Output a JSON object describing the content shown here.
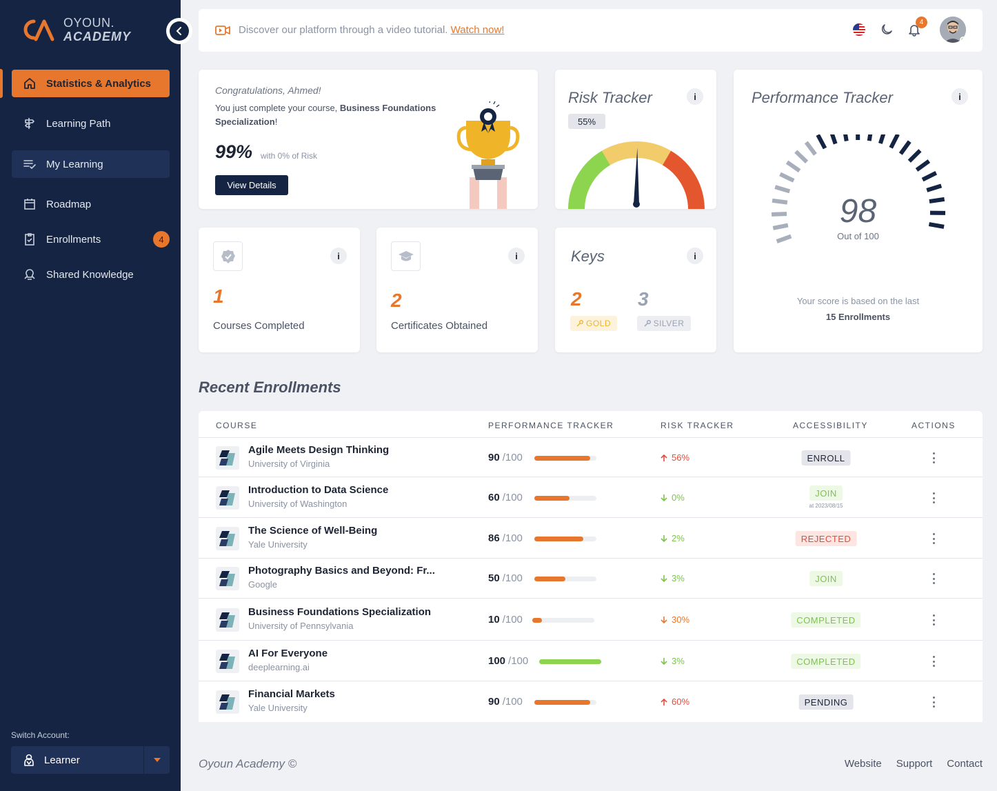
{
  "brand": {
    "line1": "OYOUN.",
    "line2": "ACADEMY",
    "accent": "#e8772e",
    "navy": "#142442"
  },
  "sidebar": {
    "items": [
      {
        "label": "Statistics & Analytics",
        "icon": "home-icon"
      },
      {
        "label": "Learning Path",
        "icon": "signpost-icon"
      },
      {
        "label": "My Learning",
        "icon": "checklist-icon"
      },
      {
        "label": "Roadmap",
        "icon": "calendar-icon"
      },
      {
        "label": "Enrollments",
        "icon": "clipboard-check-icon",
        "badge": "4"
      },
      {
        "label": "Shared Knowledge",
        "icon": "lightbulb-icon"
      }
    ],
    "switch_label": "Switch Account:",
    "switch_value": "Learner"
  },
  "header": {
    "promo_text": "Discover our platform through a video tutorial.",
    "promo_link": "Watch now!",
    "bell_count": "4"
  },
  "congrats": {
    "greeting": "Congratulations, Ahmed!",
    "text_before": "You just complete your course, ",
    "course": "Business Foundations Specialization",
    "text_after": "!",
    "percent": "99%",
    "percent_sub": "with 0% of Risk",
    "button": "View Details"
  },
  "risk_tracker": {
    "title": "Risk Tracker",
    "value": "55%",
    "level": 0.55
  },
  "performance_tracker": {
    "title": "Performance Tracker",
    "score": "98",
    "out_of": "Out of 100",
    "note": "Your score is based on the last",
    "note_bold": "15 Enrollments"
  },
  "stats": {
    "courses": {
      "value": "1",
      "label": "Courses Completed"
    },
    "certificates": {
      "value": "2",
      "label": "Certificates Obtained"
    }
  },
  "keys": {
    "title": "Keys",
    "gold": {
      "value": "2",
      "label": "GOLD"
    },
    "silver": {
      "value": "3",
      "label": "SILVER"
    }
  },
  "recent": {
    "title": "Recent Enrollments",
    "headers": [
      "COURSE",
      "PERFORMANCE TRACKER",
      "RISK TRACKER",
      "ACCESSIBILITY",
      "ACTIONS"
    ],
    "rows": [
      {
        "name": "Agile Meets Design Thinking",
        "uni": "University of Virginia",
        "score": "90",
        "of": "/100",
        "fill": 0.9,
        "risk": "56%",
        "risk_dir": "up",
        "access": "ENROLL",
        "access_type": "enroll"
      },
      {
        "name": "Introduction to Data Science",
        "uni": "University of Washington",
        "score": "60",
        "of": "/100",
        "fill": 0.57,
        "risk": "0%",
        "risk_dir": "down",
        "access": "JOIN",
        "access_type": "join",
        "access_sub": "at 2023/08/15"
      },
      {
        "name": "The Science of Well-Being",
        "uni": "Yale University",
        "score": "86",
        "of": "/100",
        "fill": 0.79,
        "risk": "2%",
        "risk_dir": "down",
        "access": "REJECTED",
        "access_type": "rejected"
      },
      {
        "name": "Photography Basics and Beyond: Fr...",
        "uni": "Google",
        "score": "50",
        "of": "/100",
        "fill": 0.5,
        "risk": "3%",
        "risk_dir": "down",
        "access": "JOIN",
        "access_type": "join"
      },
      {
        "name": "Business Foundations Specialization",
        "uni": "University of Pennsylvania",
        "score": "10",
        "of": "/100",
        "fill": 0.16,
        "risk": "30%",
        "risk_dir": "down-orange",
        "access": "COMPLETED",
        "access_type": "completed"
      },
      {
        "name": "AI For Everyone",
        "uni": "deeplearning.ai",
        "score": "100",
        "of": "/100",
        "fill": 1.0,
        "risk": "3%",
        "risk_dir": "down",
        "access": "COMPLETED",
        "access_type": "completed"
      },
      {
        "name": "Financial Markets",
        "uni": "Yale University",
        "score": "90",
        "of": "/100",
        "fill": 0.9,
        "risk": "60%",
        "risk_dir": "up",
        "access": "PENDING",
        "access_type": "pending"
      }
    ]
  },
  "footer": {
    "left": "Oyoun Academy ©",
    "links": [
      "Website",
      "Support",
      "Contact"
    ]
  }
}
